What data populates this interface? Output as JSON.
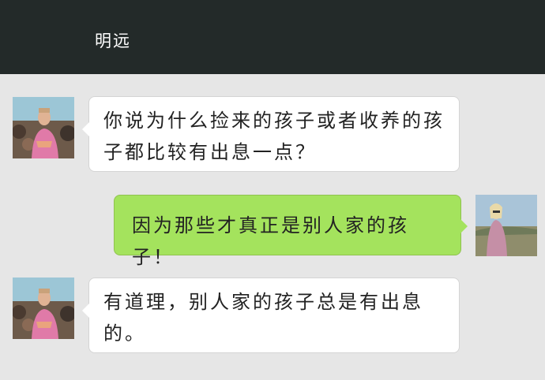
{
  "header": {
    "title": "明远"
  },
  "messages": [
    {
      "side": "left",
      "sender_avatar": "boy-avatar",
      "text": "你说为什么捡来的孩子或者收养的孩子都比较有出息一点？"
    },
    {
      "side": "right",
      "sender_avatar": "girl-avatar",
      "text": "因为那些才真正是别人家的孩子！"
    },
    {
      "side": "left",
      "sender_avatar": "boy-avatar",
      "text": "有道理，别人家的孩子总是有出息的。"
    }
  ],
  "colors": {
    "header_bg": "#232a29",
    "chat_bg": "#e6e6e6",
    "incoming_bubble": "#ffffff",
    "outgoing_bubble": "#a4e35d"
  }
}
